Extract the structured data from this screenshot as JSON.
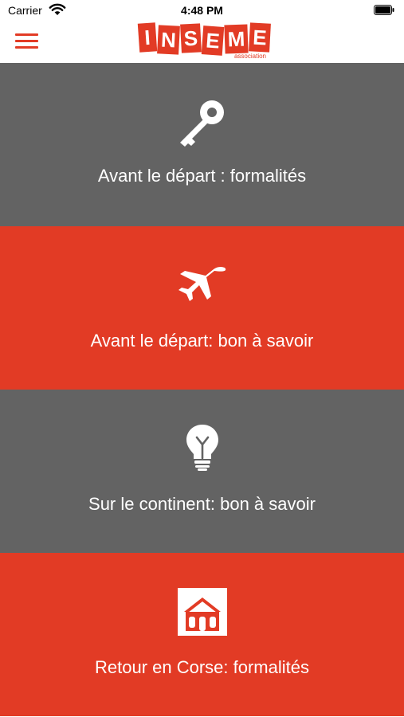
{
  "status_bar": {
    "carrier": "Carrier",
    "time": "4:48 PM"
  },
  "header": {
    "menu_icon": "hamburger-menu-icon",
    "logo": {
      "letters": [
        "I",
        "N",
        "S",
        "E",
        "M",
        "E"
      ],
      "subtitle": "association"
    }
  },
  "colors": {
    "accent_red": "#e23b25",
    "tile_gray": "#636363",
    "text_white": "#ffffff"
  },
  "tiles": [
    {
      "label": "Avant le départ : formalités",
      "icon": "key-icon",
      "color": "#636363"
    },
    {
      "label": "Avant le départ: bon à savoir",
      "icon": "airplane-icon",
      "color": "#e23b25"
    },
    {
      "label": "Sur le continent: bon à savoir",
      "icon": "lightbulb-icon",
      "color": "#636363"
    },
    {
      "label": "Retour en Corse: formalités",
      "icon": "house-icon",
      "color": "#e23b25"
    }
  ]
}
